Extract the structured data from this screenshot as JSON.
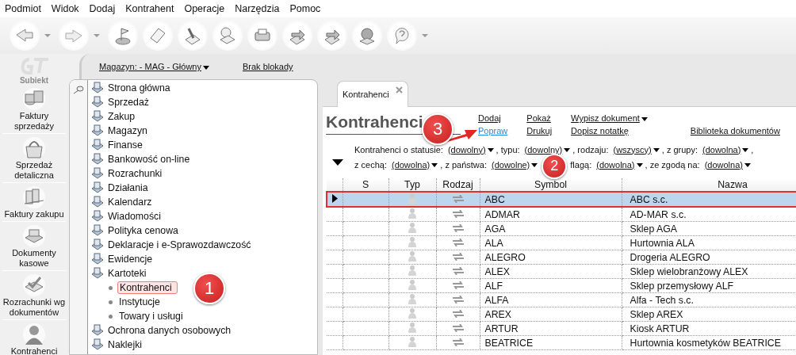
{
  "menu": [
    "Podmiot",
    "Widok",
    "Dodaj",
    "Kontrahent",
    "Operacje",
    "Narzędzia",
    "Pomoc"
  ],
  "logo": {
    "text": "Subiekt"
  },
  "sidebar": {
    "items": [
      {
        "label": "Faktury sprzedaży"
      },
      {
        "label": "Sprzedaż detaliczna"
      },
      {
        "label": "Faktury zakupu"
      },
      {
        "label": "Dokumenty kasowe"
      },
      {
        "label": "Rozrachunki wg dokumentów"
      },
      {
        "label": "Kontrahenci"
      }
    ]
  },
  "top_bar": {
    "warehouse": "Magazyn: - MAG - Główny",
    "lock": "Brak blokady"
  },
  "tree": [
    {
      "label": "Strona główna",
      "selected": false
    },
    {
      "label": "Sprzedaż",
      "selected": false
    },
    {
      "label": "Zakup",
      "selected": false
    },
    {
      "label": "Magazyn",
      "selected": false
    },
    {
      "label": "Finanse",
      "selected": false
    },
    {
      "label": "Bankowość on-line",
      "selected": false
    },
    {
      "label": "Rozrachunki",
      "selected": false
    },
    {
      "label": "Działania",
      "selected": false
    },
    {
      "label": "Kalendarz",
      "selected": false
    },
    {
      "label": "Wiadomości",
      "selected": false
    },
    {
      "label": "Polityka cenowa",
      "selected": false
    },
    {
      "label": "Deklaracje i e-Sprawozdawczość",
      "selected": false
    },
    {
      "label": "Ewidencje",
      "selected": false
    },
    {
      "label": "Kartoteki",
      "expanded": true,
      "selected": false,
      "children": [
        {
          "label": "Kontrahenci",
          "selected": true
        },
        {
          "label": "Instytucje",
          "selected": false
        },
        {
          "label": "Towary i usługi",
          "selected": false
        }
      ]
    },
    {
      "label": "Ochrona danych osobowych",
      "selected": false
    },
    {
      "label": "Naklejki",
      "selected": false
    }
  ],
  "tabs": [
    {
      "label": "Kontrahenci",
      "selected": true
    }
  ],
  "heading": "Kontrahenci",
  "actions": [
    [
      {
        "label": "Dodaj",
        "dropdown": false
      },
      {
        "label": "Popraw",
        "dropdown": false
      }
    ],
    [
      {
        "label": "Pokaż",
        "dropdown": false
      },
      {
        "label": "Drukuj",
        "dropdown": false
      }
    ],
    [
      {
        "label": "Wypisz dokument",
        "dropdown": true
      },
      {
        "label": "Dopisz notatkę",
        "dropdown": false
      }
    ],
    [
      {
        "label": "Biblioteka dokumentów",
        "dropdown": false
      }
    ]
  ],
  "filters": [
    [
      {
        "label": "Kontrahenci o statusie:",
        "value": "(dowolny)"
      },
      {
        "label": ", typu:",
        "value": "(dowolny)"
      },
      {
        "label": ", rodzaju:",
        "value": "(wszyscy)"
      },
      {
        "label": ", z grupy:",
        "value": "(dowolna)"
      },
      {
        "label": ","
      }
    ],
    [
      {
        "label": "z cechą:",
        "value": "(dowolna)"
      },
      {
        "label": ", z państwa:",
        "value": "(dowolne)"
      },
      {
        "label": "flagą:",
        "value": "(dowolna)"
      },
      {
        "label": ", ze zgodą na:",
        "value": "(dowolna)"
      }
    ]
  ],
  "table": {
    "columns": [
      "S",
      "Typ",
      "Rodzaj",
      "Symbol",
      "Nazwa"
    ],
    "rows": [
      {
        "symbol": "ABC",
        "name": "ABC s.c.",
        "selected": true
      },
      {
        "symbol": "ADMAR",
        "name": "AD-MAR s.c.",
        "selected": false
      },
      {
        "symbol": "AGA",
        "name": "Sklep AGA",
        "selected": false
      },
      {
        "symbol": "ALA",
        "name": "Hurtownia ALA",
        "selected": false
      },
      {
        "symbol": "ALEGRO",
        "name": "Drogeria ALEGRO",
        "selected": false
      },
      {
        "symbol": "ALEX",
        "name": "Sklep wielobranżowy  ALEX",
        "selected": false
      },
      {
        "symbol": "ALF",
        "name": "Sklep przemysłowy ALF",
        "selected": false
      },
      {
        "symbol": "ALFA",
        "name": "Alfa - Tech s.c.",
        "selected": false
      },
      {
        "symbol": "AREX",
        "name": "Sklep AREX",
        "selected": false
      },
      {
        "symbol": "ARTUR",
        "name": "Kiosk ARTUR",
        "selected": false
      },
      {
        "symbol": "BEATRICE",
        "name": "Hurtownia kosmetyków BEATRICE",
        "selected": false
      }
    ]
  },
  "annotations": [
    "1",
    "2",
    "3"
  ]
}
